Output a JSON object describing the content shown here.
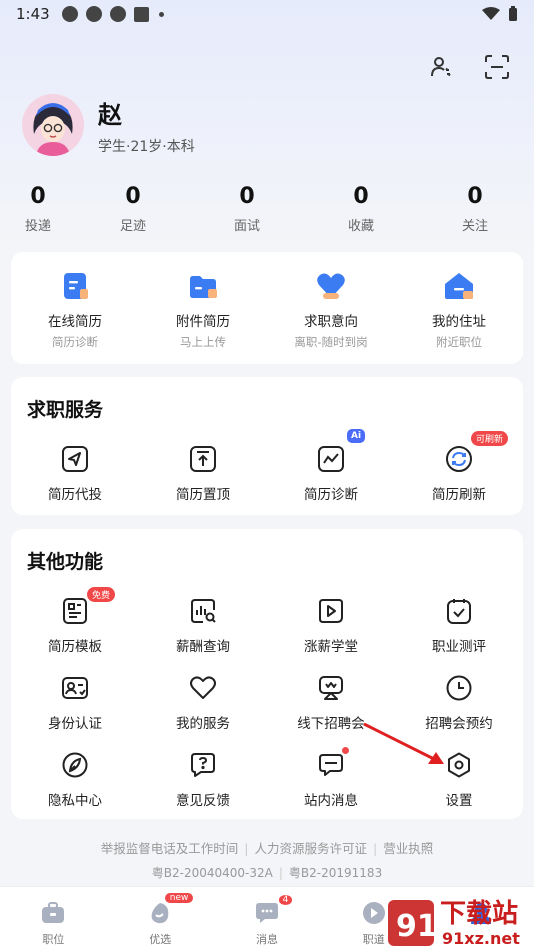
{
  "status_bar": {
    "time": "1:43"
  },
  "profile": {
    "name": "赵",
    "info": "学生·21岁·本科"
  },
  "stats": [
    {
      "num": "0",
      "label": "投递"
    },
    {
      "num": "0",
      "label": "足迹"
    },
    {
      "num": "0",
      "label": "面试"
    },
    {
      "num": "0",
      "label": "收藏"
    },
    {
      "num": "0",
      "label": "关注"
    }
  ],
  "quick": [
    {
      "title": "在线简历",
      "sub": "简历诊断",
      "icon": "resume-doc-icon"
    },
    {
      "title": "附件简历",
      "sub": "马上上传",
      "icon": "folder-icon"
    },
    {
      "title": "求职意向",
      "sub": "离职-随时到岗",
      "icon": "heart-icon"
    },
    {
      "title": "我的住址",
      "sub": "附近职位",
      "icon": "home-icon"
    }
  ],
  "services": {
    "title": "求职服务",
    "items": [
      {
        "label": "简历代投",
        "icon": "send-icon"
      },
      {
        "label": "简历置顶",
        "icon": "pin-top-icon"
      },
      {
        "label": "简历诊断",
        "icon": "diagnosis-icon",
        "badge": "Ai"
      },
      {
        "label": "简历刷新",
        "icon": "refresh-icon",
        "badge": "可刷新"
      }
    ]
  },
  "others": {
    "title": "其他功能",
    "items": [
      {
        "label": "简历模板",
        "icon": "template-icon",
        "badge": "免费"
      },
      {
        "label": "薪酬查询",
        "icon": "salary-search-icon"
      },
      {
        "label": "涨薪学堂",
        "icon": "play-icon"
      },
      {
        "label": "职业测评",
        "icon": "assessment-icon"
      },
      {
        "label": "身份认证",
        "icon": "id-card-icon"
      },
      {
        "label": "我的服务",
        "icon": "heart-outline-icon"
      },
      {
        "label": "线下招聘会",
        "icon": "job-fair-icon"
      },
      {
        "label": "招聘会预约",
        "icon": "clock-icon"
      },
      {
        "label": "隐私中心",
        "icon": "privacy-icon"
      },
      {
        "label": "意见反馈",
        "icon": "feedback-icon"
      },
      {
        "label": "站内消息",
        "icon": "message-icon"
      },
      {
        "label": "设置",
        "icon": "settings-icon"
      }
    ]
  },
  "footer": {
    "links": [
      "举报监督电话及工作时间",
      "人力资源服务许可证",
      "营业执照"
    ],
    "license1": "粤B2-20040400-32A",
    "license2": "粤B2-20191183"
  },
  "tabs": [
    {
      "label": "职位",
      "icon": "briefcase-icon"
    },
    {
      "label": "优选",
      "icon": "preferred-icon",
      "badge": "new"
    },
    {
      "label": "消息",
      "icon": "chat-icon",
      "badge": "4"
    },
    {
      "label": "职道",
      "icon": "path-icon"
    },
    {
      "label": "",
      "icon": "profile-icon"
    }
  ],
  "watermark": {
    "main": "下载站",
    "site": "91xz.net",
    "mark": "91"
  },
  "colors": {
    "accent": "#3a7df0",
    "badge": "#f04848",
    "annotation_arrow": "#e02020"
  }
}
